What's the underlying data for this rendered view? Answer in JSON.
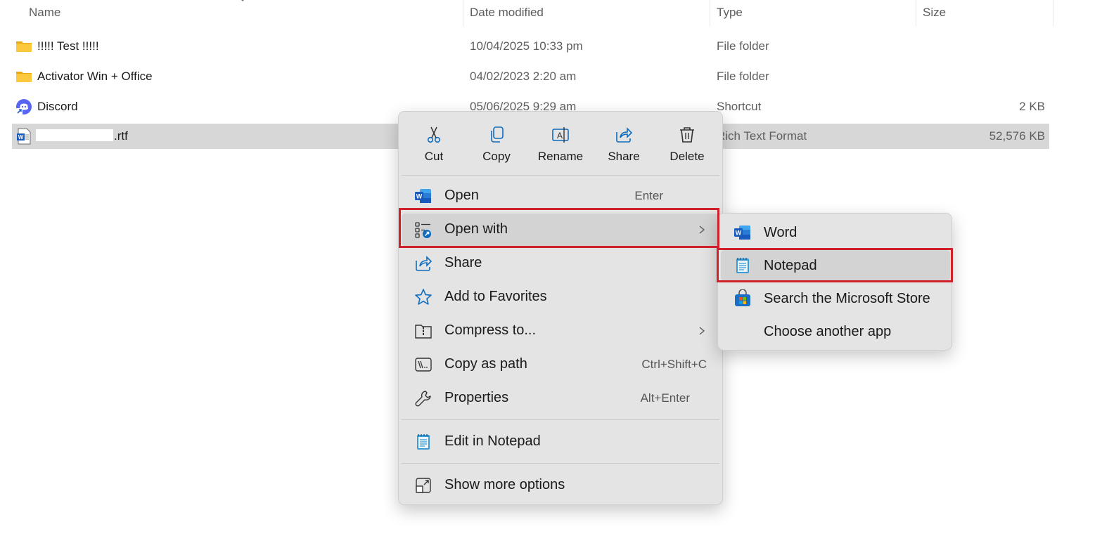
{
  "columns": {
    "name": "Name",
    "date_modified": "Date modified",
    "type": "Type",
    "size": "Size"
  },
  "files": [
    {
      "name": "!!!!! Test !!!!!",
      "date": "10/04/2025 10:33 pm",
      "type": "File folder",
      "size": "",
      "icon": "folder-icon"
    },
    {
      "name": "Activator Win + Office",
      "date": "04/02/2023 2:20 am",
      "type": "File folder",
      "size": "",
      "icon": "folder-icon"
    },
    {
      "name": "Discord",
      "date": "05/06/2025 9:29 am",
      "type": "Shortcut",
      "size": "2 KB",
      "icon": "discord-icon"
    },
    {
      "name": ".rtf",
      "date": "",
      "type": "Rich Text Format",
      "size": "52,576 KB",
      "icon": "word-doc-icon",
      "selected": true
    }
  ],
  "context_menu": {
    "quick_actions": [
      {
        "label": "Cut",
        "icon": "scissors-icon"
      },
      {
        "label": "Copy",
        "icon": "copy-icon"
      },
      {
        "label": "Rename",
        "icon": "rename-icon"
      },
      {
        "label": "Share",
        "icon": "share-icon"
      },
      {
        "label": "Delete",
        "icon": "trash-icon"
      }
    ],
    "items": [
      {
        "label": "Open",
        "accelerator": "Enter",
        "icon": "word-icon"
      },
      {
        "label": "Open with",
        "accelerator": "",
        "icon": "open-with-icon",
        "has_submenu": true
      },
      {
        "label": "Share",
        "accelerator": "",
        "icon": "share-icon"
      },
      {
        "label": "Add to Favorites",
        "accelerator": "",
        "icon": "star-icon"
      },
      {
        "label": "Compress to...",
        "accelerator": "",
        "icon": "zip-folder-icon",
        "has_submenu": true
      },
      {
        "label": "Copy as path",
        "accelerator": "Ctrl+Shift+C",
        "icon": "copy-path-icon"
      },
      {
        "label": "Properties",
        "accelerator": "Alt+Enter",
        "icon": "wrench-icon"
      },
      {
        "label": "Edit in Notepad",
        "accelerator": "",
        "icon": "notepad-icon"
      },
      {
        "label": "Show more options",
        "accelerator": "",
        "icon": "more-options-icon"
      }
    ]
  },
  "submenu": {
    "items": [
      {
        "label": "Word",
        "icon": "word-icon"
      },
      {
        "label": "Notepad",
        "icon": "notepad-icon"
      },
      {
        "label": "Search the Microsoft Store",
        "icon": "store-icon"
      },
      {
        "label": "Choose another app",
        "icon": ""
      }
    ]
  },
  "colors": {
    "highlight": "#d0202a",
    "selection": "#d7d7d7",
    "menu_bg": "#e4e4e4",
    "accent": "#0067c0"
  }
}
